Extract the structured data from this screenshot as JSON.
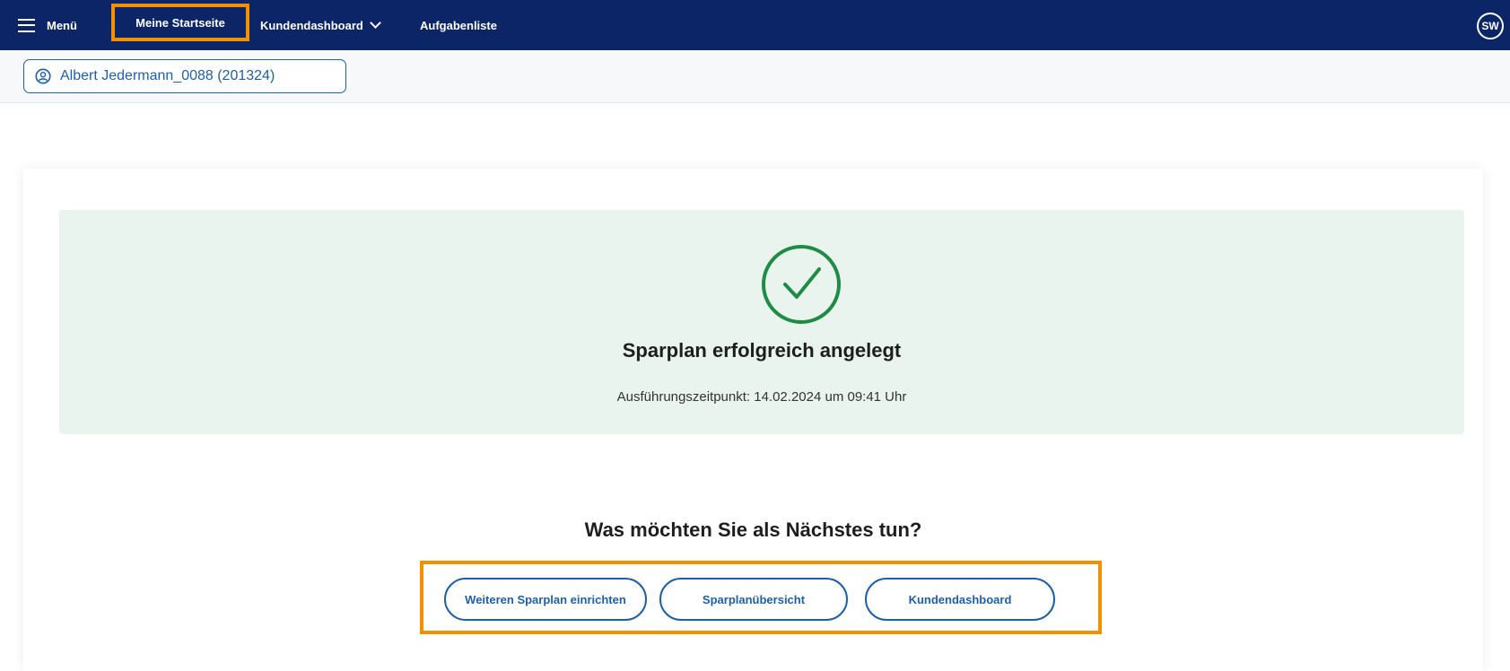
{
  "topbar": {
    "menu_label": "Menü",
    "home_label": "Meine Startseite",
    "dashboard_label": "Kundendashboard",
    "tasks_label": "Aufgabenliste",
    "avatar_initials": "SW",
    "background_color": "#0b2566",
    "highlight_color": "#f29100"
  },
  "customer": {
    "label": "Albert Jedermann_0088 (201324)",
    "icon": "user-circle-icon"
  },
  "success": {
    "icon": "check-circle-icon",
    "title": "Sparplan erfolgreich angelegt",
    "subtitle": "Ausführungszeitpunkt: 14.02.2024 um 09:41 Uhr",
    "accent_color": "#1e8c45",
    "background_color": "#e9f4ee"
  },
  "next": {
    "title": "Was möchten Sie als Nächstes tun?",
    "actions": [
      {
        "label": "Weiteren Sparplan einrichten"
      },
      {
        "label": "Sparplanübersicht"
      },
      {
        "label": "Kundendashboard"
      }
    ]
  }
}
